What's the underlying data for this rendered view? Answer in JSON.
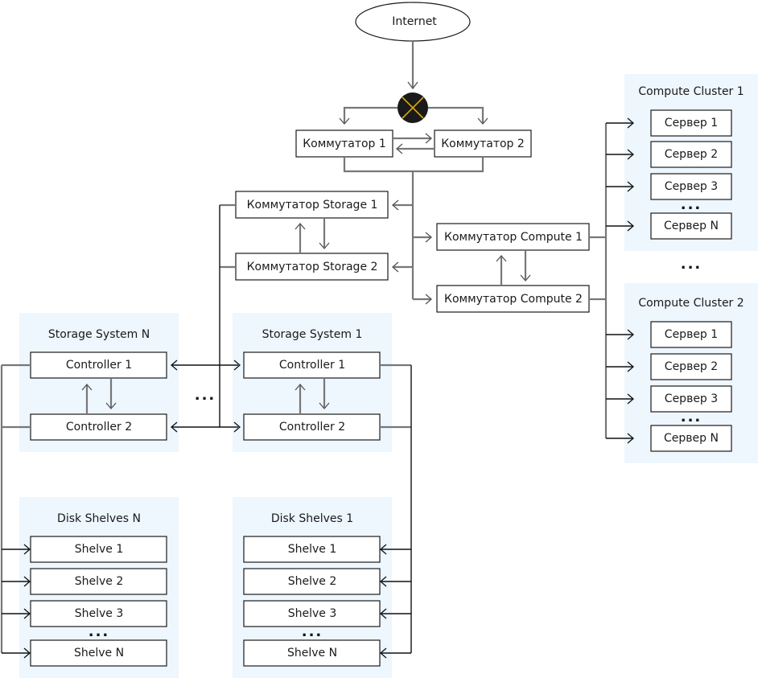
{
  "internet": {
    "label": "Internet"
  },
  "router": {
    "icon": "router-icon",
    "color": "#1a1a1a",
    "accent": "#e0a800"
  },
  "switches": {
    "core": [
      "Коммутатор 1",
      "Коммутатор 2"
    ],
    "storage": [
      "Коммутатор Storage 1",
      "Коммутатор Storage 2"
    ],
    "compute": [
      "Коммутатор Compute 1",
      "Коммутатор Compute 2"
    ]
  },
  "compute_clusters": [
    {
      "title": "Compute Cluster 1",
      "servers": [
        "Сервер 1",
        "Сервер 2",
        "Сервер 3",
        "Сервер N"
      ]
    },
    {
      "title": "Compute Cluster 2",
      "servers": [
        "Сервер 1",
        "Сервер 2",
        "Сервер 3",
        "Сервер N"
      ]
    }
  ],
  "storage_systems": [
    {
      "title": "Storage System N",
      "controllers": [
        "Controller 1",
        "Controller 2"
      ]
    },
    {
      "title": "Storage System 1",
      "controllers": [
        "Controller 1",
        "Controller 2"
      ]
    }
  ],
  "disk_shelves": [
    {
      "title": "Disk Shelves N",
      "shelves": [
        "Shelve 1",
        "Shelve 2",
        "Shelve 3",
        "Shelve N"
      ]
    },
    {
      "title": "Disk Shelves 1",
      "shelves": [
        "Shelve 1",
        "Shelve 2",
        "Shelve 3",
        "Shelve N"
      ]
    }
  ],
  "ellipsis": "..."
}
